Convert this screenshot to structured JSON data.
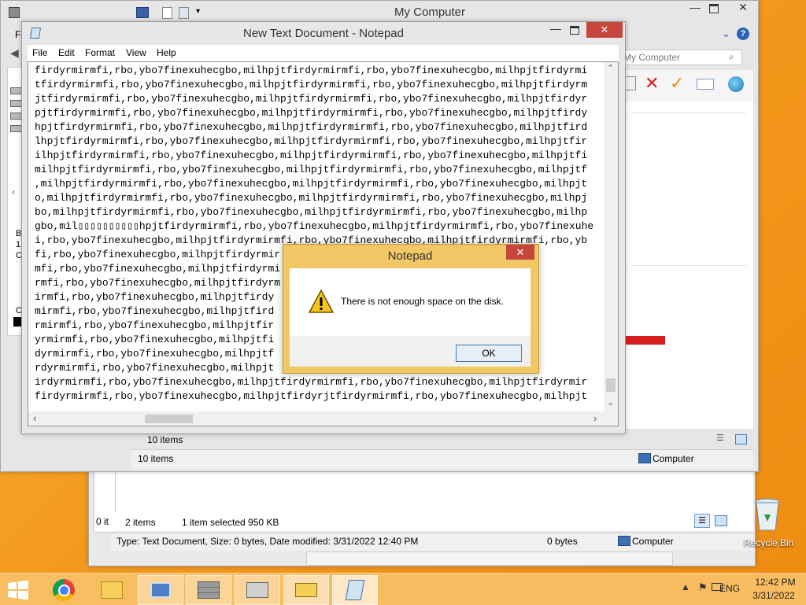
{
  "explorer_back": {
    "status_items": "2 items",
    "status_selected": "1 item selected  950 KB",
    "status_zero": "0 it",
    "details": "Type: Text Document, Size: 0 bytes, Date modified: 3/31/2022 12:40 PM",
    "details_size": "0 bytes",
    "details_location": "Computer"
  },
  "explorer_front": {
    "title": "My Computer",
    "menu_first": "Fi",
    "search_placeholder": "My Computer",
    "side_text": [
      "B",
      "1.",
      "C"
    ],
    "side_text2": "C",
    "items_inner": "10 items",
    "items_status": "10 items",
    "location": "Computer"
  },
  "notepad": {
    "title": "New Text Document - Notepad",
    "menu": [
      "File",
      "Edit",
      "Format",
      "View",
      "Help"
    ],
    "lines": [
      "firdyrmirmfi,rbo,ybo7finexuhecgbo,milhpjtfirdyrmirmfi,rbo,ybo7finexuhecgbo,milhpjtfirdyrmi",
      "tfirdyrmirmfi,rbo,ybo7finexuhecgbo,milhpjtfirdyrmirmfi,rbo,ybo7finexuhecgbo,milhpjtfirdyrm",
      "jtfirdyrmirmfi,rbo,ybo7finexuhecgbo,milhpjtfirdyrmirmfi,rbo,ybo7finexuhecgbo,milhpjtfirdyr",
      "pjtfirdyrmirmfi,rbo,ybo7finexuhecgbo,milhpjtfirdyrmirmfi,rbo,ybo7finexuhecgbo,milhpjtfirdy",
      "hpjtfirdyrmirmfi,rbo,ybo7finexuhecgbo,milhpjtfirdyrmirmfi,rbo,ybo7finexuhecgbo,milhpjtfird",
      "lhpjtfirdyrmirmfi,rbo,ybo7finexuhecgbo,milhpjtfirdyrmirmfi,rbo,ybo7finexuhecgbo,milhpjtfir",
      "ilhpjtfirdyrmirmfi,rbo,ybo7finexuhecgbo,milhpjtfirdyrmirmfi,rbo,ybo7finexuhecgbo,milhpjtfi",
      "milhpjtfirdyrmirmfi,rbo,ybo7finexuhecgbo,milhpjtfirdyrmirmfi,rbo,ybo7finexuhecgbo,milhpjtf",
      ",milhpjtfirdyrmirmfi,rbo,ybo7finexuhecgbo,milhpjtfirdyrmirmfi,rbo,ybo7finexuhecgbo,milhpjt",
      "o,milhpjtfirdyrmirmfi,rbo,ybo7finexuhecgbo,milhpjtfirdyrmirmfi,rbo,ybo7finexuhecgbo,milhpj",
      "bo,milhpjtfirdyrmirmfi,rbo,ybo7finexuhecgbo,milhpjtfirdyrmirmfi,rbo,ybo7finexuhecgbo,milhp",
      "gbo,mil▯▯▯▯▯▯▯▯▯▯hpjtfirdyrmirmfi,rbo,ybo7finexuhecgbo,milhpjtfirdyrmirmfi,rbo,ybo7finexuhe",
      "i,rbo,ybo7finexuhecgbo,milhpjtfirdyrmirmfi,rbo,ybo7finexuhecgbo,milhpjtfirdyrmirmfi,rbo,yb",
      "fi,rbo,ybo7finexuhecgbo,milhpjtfirdyrmir                     rmfi,rbo,y",
      "mfi,rbo,ybo7finexuhecgbo,milhpjtfirdyrmi                     irmfi,rbo,",
      "rmfi,rbo,ybo7finexuhecgbo,milhpjtfirdyrm                     mirmfi,rbo",
      "irmfi,rbo,ybo7finexuhecgbo,milhpjtfirdy                      rmirmfi,rb",
      "mirmfi,rbo,ybo7finexuhecgbo,milhpjtfird                      yrmirmfi,r",
      "rmirmfi,rbo,ybo7finexuhecgbo,milhpjtfir                      dyrmirmfi,",
      "yrmirmfi,rbo,ybo7finexuhecgbo,milhpjtfi                      irdyrmirmfi",
      "dyrmirmfi,rbo,ybo7finexuhecgbo,milhpjtf                      firdyrmirmf",
      "rdyrmirmfi,rbo,ybo7finexuhecgbo,milhpjt                      tfirdyrmirm",
      "irdyrmirmfi,rbo,ybo7finexuhecgbo,milhpjtfirdyrmirmfi,rbo,ybo7finexuhecgbo,milhpjtfirdyrmir",
      "firdyrmirmfi,rbo,ybo7finexuhecgbo,milhpjtfirdyrjtfirdyrmirmfi,rbo,ybo7finexuhecgbo,milhpjt"
    ]
  },
  "dialog": {
    "title": "Notepad",
    "message": "There is not enough space on the disk.",
    "ok_label": "OK"
  },
  "desktop": {
    "recycle_bin_label": "Recycle Bin"
  },
  "taskbar": {
    "language": "ENG",
    "time": "12:42 PM",
    "date": "3/31/2022"
  }
}
